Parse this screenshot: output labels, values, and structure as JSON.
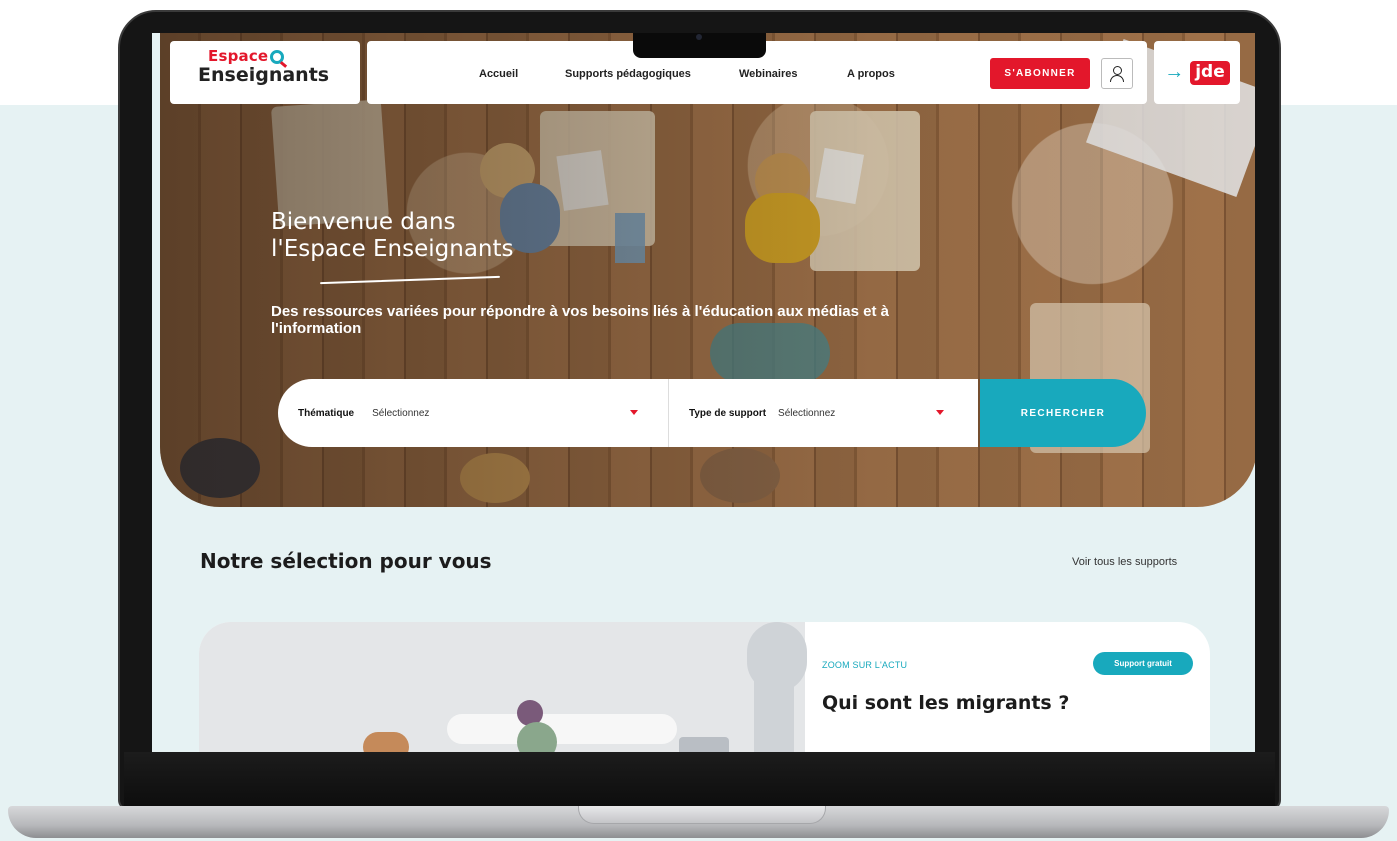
{
  "header": {
    "logo_top": "Espace",
    "logo_bottom": "Enseignants",
    "nav": [
      "Accueil",
      "Supports pédagogiques",
      "Webinaires",
      "A propos"
    ],
    "subscribe_label": "S'ABONNER",
    "partner_logo": "jde"
  },
  "hero": {
    "title_line1": "Bienvenue dans",
    "title_line2": "l'Espace Enseignants",
    "subtitle": "Des ressources variées pour répondre à vos besoins liés à l'éducation aux médias et à l'information"
  },
  "search": {
    "theme_label": "Thématique",
    "theme_value": "Sélectionnez",
    "type_label": "Type de support",
    "type_value": "Sélectionnez",
    "button_label": "RECHERCHER"
  },
  "selection": {
    "title": "Notre sélection pour vous",
    "see_all": "Voir tous les supports",
    "card": {
      "tag": "ZOOM SUR L'ACTU",
      "badge": "Support gratuit",
      "title": "Qui sont les migrants ?"
    }
  },
  "colors": {
    "brand_red": "#e3172b",
    "brand_teal": "#18a9bd",
    "page_bg": "#e6f2f3"
  },
  "icons": [
    "user-icon",
    "arrow-right-icon",
    "caret-down-icon"
  ]
}
